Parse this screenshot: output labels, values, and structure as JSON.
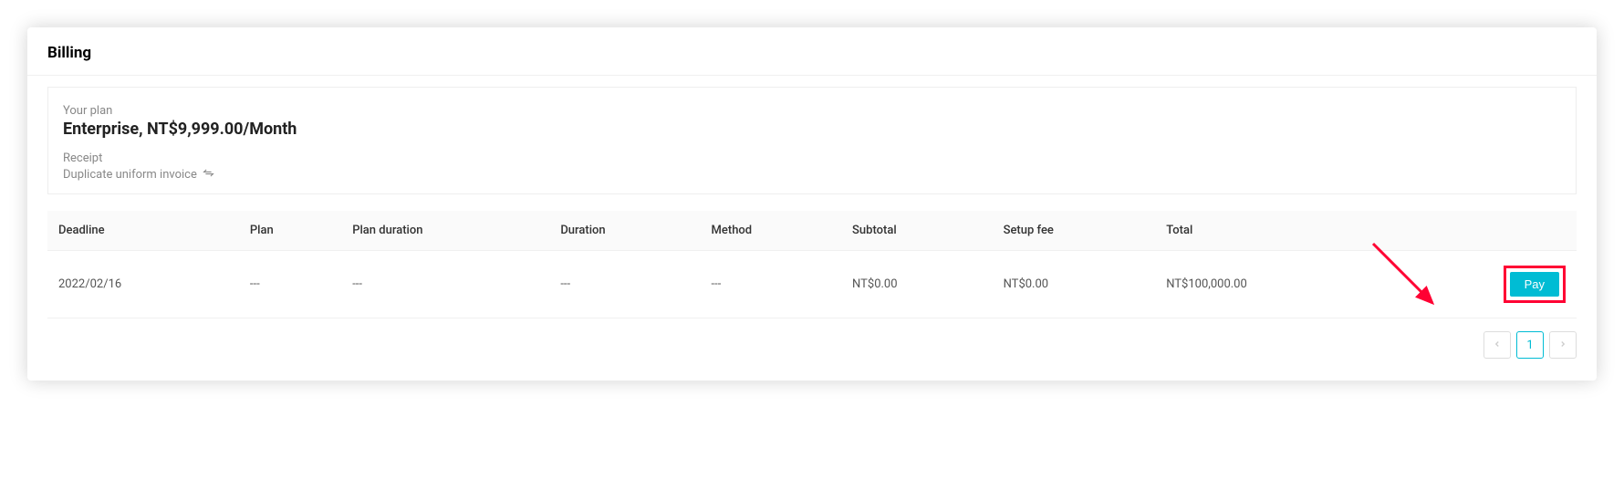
{
  "header": {
    "title": "Billing"
  },
  "plan": {
    "label": "Your plan",
    "value": "Enterprise, NT$9,999.00/Month"
  },
  "receipt": {
    "label": "Receipt",
    "value": "Duplicate uniform invoice"
  },
  "table": {
    "headers": {
      "deadline": "Deadline",
      "plan": "Plan",
      "plan_duration": "Plan duration",
      "duration": "Duration",
      "method": "Method",
      "subtotal": "Subtotal",
      "setup_fee": "Setup fee",
      "total": "Total"
    },
    "row": {
      "deadline": "2022/02/16",
      "plan": "---",
      "plan_duration": "---",
      "duration": "---",
      "method": "---",
      "subtotal": "NT$0.00",
      "setup_fee": "NT$0.00",
      "total": "NT$100,000.00",
      "pay_label": "Pay"
    }
  },
  "pagination": {
    "current": "1"
  }
}
